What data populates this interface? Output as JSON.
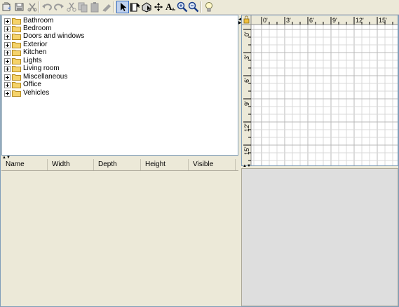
{
  "toolbar": {
    "buttons": [
      {
        "name": "open-icon"
      },
      {
        "name": "save-icon"
      },
      {
        "name": "cut-disabled-icon"
      },
      {
        "name": "undo-icon"
      },
      {
        "name": "redo-icon"
      },
      {
        "name": "cut-icon"
      },
      {
        "name": "copy-icon"
      },
      {
        "name": "paste-icon"
      },
      {
        "name": "add-furniture-icon"
      },
      {
        "name": "select-mode-icon",
        "selected": true
      },
      {
        "name": "create-walls-icon"
      },
      {
        "name": "create-rooms-icon"
      },
      {
        "name": "create-dimensions-icon"
      },
      {
        "name": "add-text-icon"
      },
      {
        "name": "zoom-in-icon"
      },
      {
        "name": "zoom-out-icon"
      },
      {
        "name": "light-bulb-icon"
      }
    ]
  },
  "catalog": {
    "categories": [
      "Bathroom",
      "Bedroom",
      "Doors and windows",
      "Exterior",
      "Kitchen",
      "Lights",
      "Living room",
      "Miscellaneous",
      "Office",
      "Vehicles"
    ]
  },
  "furniture_table": {
    "columns": [
      "Name",
      "Width",
      "Depth",
      "Height",
      "Visible"
    ]
  },
  "plan": {
    "ruler_top": [
      "0'",
      "3'",
      "6'",
      "9'",
      "12'",
      "15'"
    ],
    "ruler_left": [
      "0'",
      "3'",
      "6'",
      "9'",
      "12'",
      "15'"
    ]
  },
  "colors": {
    "panel_bg": "#ece9d8",
    "grid_line": "#d8d8d8",
    "grid_major": "#b8b8b8",
    "view3d_bg": "#dedede",
    "folder_yellow": "#f5d36b"
  }
}
